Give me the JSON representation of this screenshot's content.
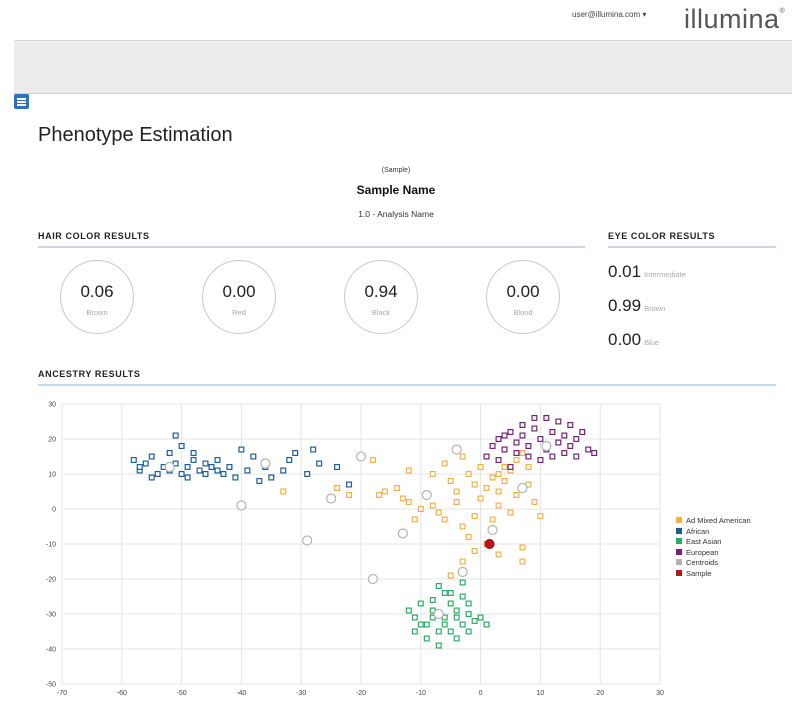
{
  "header": {
    "user_menu": "user@illumina.com ▾",
    "logo": "illumina",
    "logo_mark": "®"
  },
  "page": {
    "title": "Phenotype Estimation",
    "sample_tag": "(Sample)",
    "sample_name": "Sample Name",
    "analysis": "1.0 - Analysis Name"
  },
  "hair": {
    "title": "HAIR COLOR RESULTS",
    "items": [
      {
        "value": "0.06",
        "label": "Brown"
      },
      {
        "value": "0.00",
        "label": "Red"
      },
      {
        "value": "0.94",
        "label": "Black"
      },
      {
        "value": "0.00",
        "label": "Blond"
      }
    ]
  },
  "eye": {
    "title": "EYE COLOR RESULTS",
    "items": [
      {
        "value": "0.01",
        "label": "Intermediate"
      },
      {
        "value": "0.99",
        "label": "Brown"
      },
      {
        "value": "0.00",
        "label": "Blue"
      }
    ]
  },
  "ancestry": {
    "title": "ANCESTRY RESULTS"
  },
  "chart_data": {
    "type": "scatter",
    "title": "",
    "xlabel": "",
    "ylabel": "",
    "xlim": [
      -70,
      30
    ],
    "ylim": [
      -50,
      30
    ],
    "xticks": [
      -70,
      -60,
      -50,
      -40,
      -30,
      -20,
      -10,
      0,
      10,
      20,
      30
    ],
    "yticks": [
      30,
      20,
      10,
      0,
      -10,
      -20,
      -30,
      -40,
      -50
    ],
    "grid": true,
    "legend_position": "right",
    "series": [
      {
        "name": "Ad Mixed American",
        "color": "#f5b041",
        "marker": "hollow-square",
        "points": [
          [
            -33,
            5
          ],
          [
            -24,
            6
          ],
          [
            -17,
            4
          ],
          [
            -16,
            5
          ],
          [
            -14,
            6
          ],
          [
            -13,
            3
          ],
          [
            -12,
            2
          ],
          [
            -10,
            0
          ],
          [
            -11,
            -3
          ],
          [
            -7,
            -1
          ],
          [
            -9,
            4
          ],
          [
            -6,
            -3
          ],
          [
            -4,
            2
          ],
          [
            -3,
            -5
          ],
          [
            -2,
            -8
          ],
          [
            -1,
            -2
          ],
          [
            0,
            3
          ],
          [
            1,
            6
          ],
          [
            2,
            9
          ],
          [
            3,
            5
          ],
          [
            4,
            8
          ],
          [
            5,
            11
          ],
          [
            6,
            14
          ],
          [
            7,
            16
          ],
          [
            8,
            12
          ],
          [
            3,
            1
          ],
          [
            5,
            -1
          ],
          [
            2,
            -3
          ],
          [
            -5,
            8
          ],
          [
            -2,
            10
          ],
          [
            0,
            12
          ],
          [
            6,
            4
          ],
          [
            9,
            2
          ],
          [
            10,
            -2
          ],
          [
            -4,
            5
          ],
          [
            -8,
            10
          ],
          [
            -6,
            13
          ],
          [
            -3,
            15
          ],
          [
            1,
            15
          ],
          [
            4,
            12
          ],
          [
            -1,
            -12
          ],
          [
            1,
            -10
          ],
          [
            3,
            -13
          ],
          [
            7,
            -11
          ],
          [
            7,
            -15
          ],
          [
            -3,
            -15
          ],
          [
            -5,
            -19
          ],
          [
            -8,
            1
          ],
          [
            -1,
            7
          ],
          [
            3,
            10
          ],
          [
            8,
            7
          ],
          [
            -22,
            4
          ],
          [
            -12,
            11
          ],
          [
            -18,
            14
          ]
        ]
      },
      {
        "name": "African",
        "color": "#1f5c99",
        "marker": "hollow-square",
        "points": [
          [
            -58,
            14
          ],
          [
            -57,
            11
          ],
          [
            -56,
            13
          ],
          [
            -55,
            15
          ],
          [
            -54,
            10
          ],
          [
            -53,
            12
          ],
          [
            -52,
            11
          ],
          [
            -51,
            13
          ],
          [
            -50,
            10
          ],
          [
            -49,
            12
          ],
          [
            -48,
            14
          ],
          [
            -47,
            11
          ],
          [
            -46,
            13
          ],
          [
            -45,
            12
          ],
          [
            -44,
            11
          ],
          [
            -43,
            10
          ],
          [
            -42,
            12
          ],
          [
            -41,
            9
          ],
          [
            -50,
            18
          ],
          [
            -52,
            16
          ],
          [
            -55,
            9
          ],
          [
            -57,
            12
          ],
          [
            -49,
            9
          ],
          [
            -46,
            10
          ],
          [
            -44,
            14
          ],
          [
            -40,
            17
          ],
          [
            -38,
            15
          ],
          [
            -36,
            12
          ],
          [
            -35,
            9
          ],
          [
            -33,
            11
          ],
          [
            -32,
            14
          ],
          [
            -31,
            16
          ],
          [
            -29,
            10
          ],
          [
            -27,
            13
          ],
          [
            -24,
            12
          ],
          [
            -22,
            7
          ],
          [
            -28,
            17
          ],
          [
            -37,
            8
          ],
          [
            -39,
            11
          ],
          [
            -51,
            21
          ],
          [
            -48,
            16
          ]
        ]
      },
      {
        "name": "East Asian",
        "color": "#27ae60",
        "marker": "hollow-square",
        "points": [
          [
            -12,
            -29
          ],
          [
            -11,
            -31
          ],
          [
            -10,
            -27
          ],
          [
            -9,
            -33
          ],
          [
            -8,
            -29
          ],
          [
            -7,
            -35
          ],
          [
            -6,
            -31
          ],
          [
            -5,
            -27
          ],
          [
            -4,
            -29
          ],
          [
            -3,
            -33
          ],
          [
            -2,
            -30
          ],
          [
            -1,
            -32
          ],
          [
            -9,
            -37
          ],
          [
            -7,
            -39
          ],
          [
            -5,
            -35
          ],
          [
            -3,
            -25
          ],
          [
            -6,
            -24
          ],
          [
            -8,
            -26
          ],
          [
            -10,
            -33
          ],
          [
            -4,
            -37
          ],
          [
            -2,
            -27
          ],
          [
            0,
            -31
          ],
          [
            1,
            -33
          ],
          [
            -11,
            -35
          ],
          [
            -6,
            -33
          ],
          [
            -8,
            -31
          ],
          [
            -4,
            -31
          ],
          [
            -5,
            -24
          ],
          [
            -7,
            -22
          ],
          [
            -3,
            -21
          ],
          [
            -2,
            -35
          ]
        ]
      },
      {
        "name": "European",
        "color": "#7b1f7a",
        "marker": "hollow-square",
        "points": [
          [
            1,
            15
          ],
          [
            2,
            18
          ],
          [
            3,
            20
          ],
          [
            4,
            17
          ],
          [
            5,
            22
          ],
          [
            6,
            19
          ],
          [
            7,
            21
          ],
          [
            8,
            18
          ],
          [
            9,
            23
          ],
          [
            10,
            20
          ],
          [
            11,
            17
          ],
          [
            12,
            22
          ],
          [
            13,
            19
          ],
          [
            14,
            21
          ],
          [
            15,
            18
          ],
          [
            16,
            20
          ],
          [
            17,
            22
          ],
          [
            18,
            17
          ],
          [
            19,
            16
          ],
          [
            6,
            16
          ],
          [
            8,
            15
          ],
          [
            10,
            14
          ],
          [
            12,
            15
          ],
          [
            14,
            16
          ],
          [
            16,
            15
          ],
          [
            4,
            21
          ],
          [
            9,
            26
          ],
          [
            11,
            26
          ],
          [
            13,
            25
          ],
          [
            15,
            24
          ],
          [
            7,
            24
          ],
          [
            5,
            12
          ],
          [
            3,
            14
          ]
        ]
      },
      {
        "name": "Centroids",
        "color": "#b3b3b3",
        "marker": "hollow-circle",
        "points": [
          [
            -52,
            12
          ],
          [
            -40,
            1
          ],
          [
            -36,
            13
          ],
          [
            -29,
            -9
          ],
          [
            -25,
            3
          ],
          [
            -20,
            15
          ],
          [
            -18,
            -20
          ],
          [
            -13,
            -7
          ],
          [
            -9,
            4
          ],
          [
            -7,
            -30
          ],
          [
            -4,
            17
          ],
          [
            -3,
            -18
          ],
          [
            2,
            -6
          ],
          [
            7,
            6
          ],
          [
            11,
            18
          ]
        ]
      },
      {
        "name": "Sample",
        "color": "#c0141c",
        "marker": "filled-circle",
        "points": [
          [
            1.5,
            -10
          ]
        ]
      }
    ]
  }
}
